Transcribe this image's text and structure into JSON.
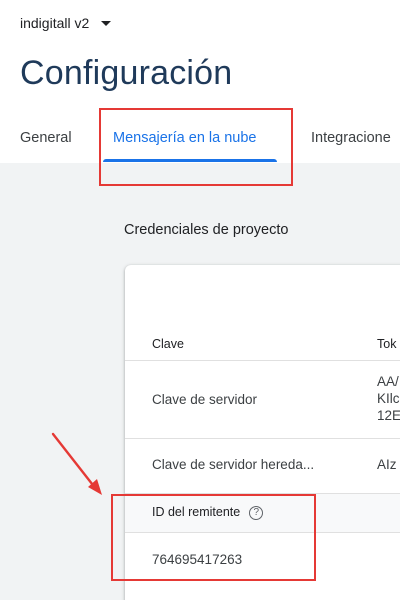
{
  "project": {
    "name": "indigitall v2"
  },
  "page": {
    "title": "Configuración"
  },
  "tabs": [
    {
      "label": "General"
    },
    {
      "label": "Mensajería en la nube"
    },
    {
      "label": "Integracione"
    }
  ],
  "section": {
    "title": "Credenciales de proyecto"
  },
  "table": {
    "headers": {
      "key": "Clave",
      "token": "Tok"
    },
    "rows": [
      {
        "key": "Clave de servidor",
        "token_lines": [
          "AA/",
          "KIlc",
          "12E"
        ]
      },
      {
        "key": "Clave de servidor hereda...",
        "token": "AIz"
      }
    ]
  },
  "sender": {
    "header": "ID del remitente",
    "help_icon": "question-circle-icon",
    "value": "764695417263"
  },
  "colors": {
    "accent": "#1a73e8",
    "annotation": "#e53935",
    "title": "#1f3a5a"
  }
}
